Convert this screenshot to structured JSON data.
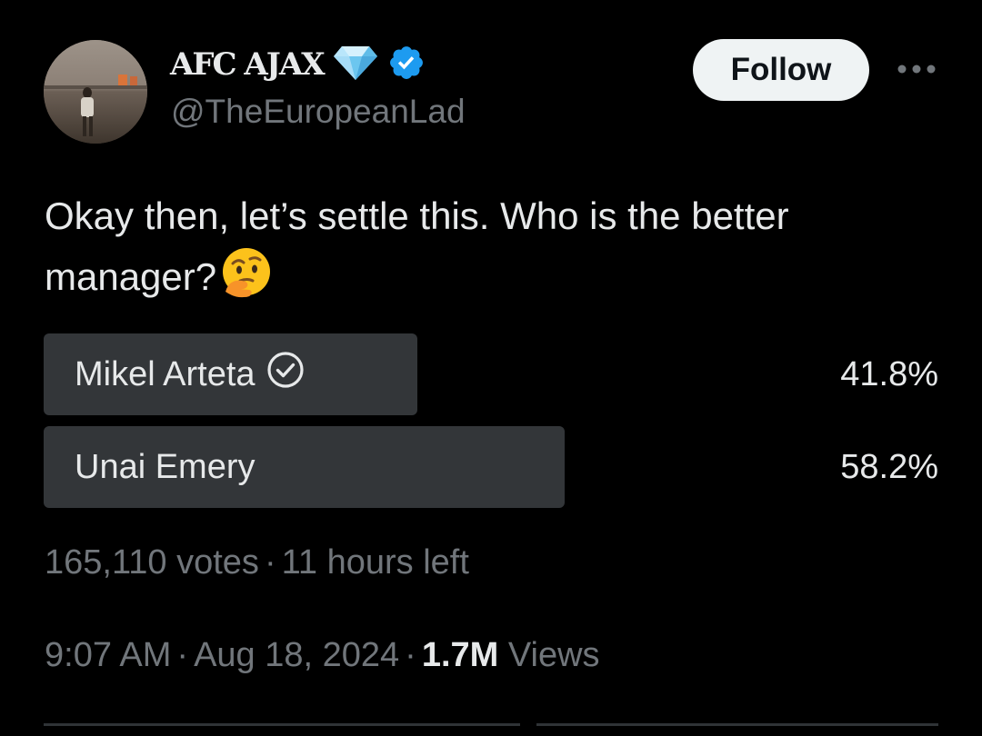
{
  "author": {
    "display_name": "AFC AJAX",
    "handle": "@TheEuropeanLad",
    "verified": true,
    "emoji_badge": "gem-icon",
    "verified_color": "#1d9bf0"
  },
  "actions": {
    "follow_label": "Follow",
    "more_icon": "more-horizontal-icon"
  },
  "tweet": {
    "text": "Okay then, let’s settle this. Who is the better manager?",
    "emoji": "thinking-face-icon"
  },
  "poll": {
    "options": [
      {
        "label": "Mikel Arteta",
        "percent": 41.8,
        "percent_label": "41.8%",
        "selected": true
      },
      {
        "label": "Unai Emery",
        "percent": 58.2,
        "percent_label": "58.2%",
        "selected": false
      }
    ],
    "votes": "165,110 votes",
    "time_left": "11 hours left"
  },
  "meta": {
    "time": "9:07 AM",
    "date": "Aug 18, 2024",
    "views_count": "1.7M",
    "views_label": "Views",
    "separator": "·"
  },
  "colors": {
    "background": "#000000",
    "text_primary": "#e7e9ea",
    "text_secondary": "#71767b",
    "poll_bar": "#333639",
    "follow_bg": "#eff3f4"
  }
}
